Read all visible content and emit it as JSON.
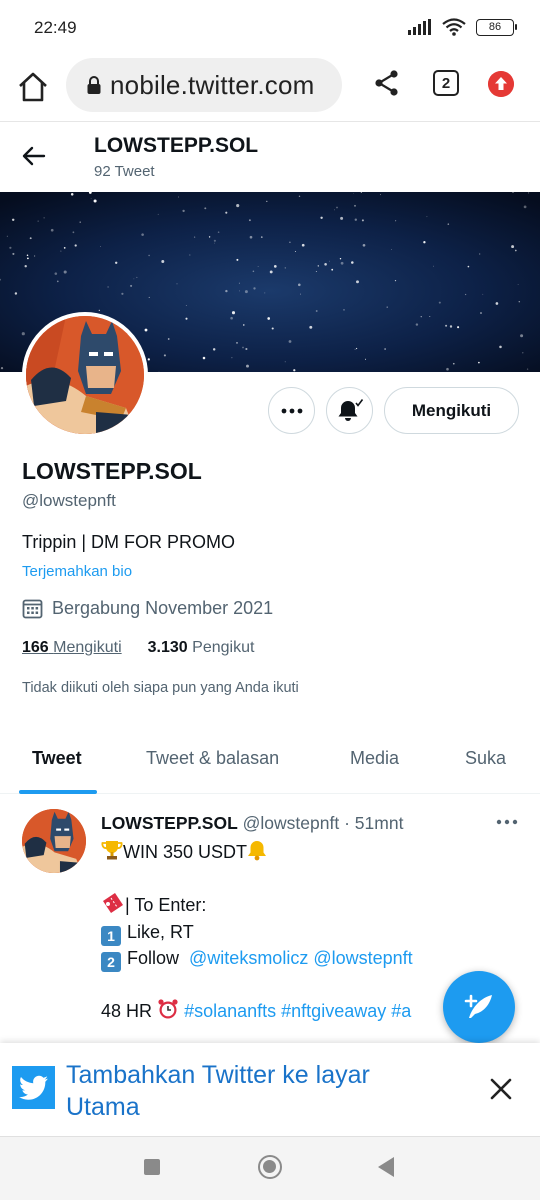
{
  "status_bar": {
    "time": "22:49",
    "battery": "86"
  },
  "browser": {
    "url": "nobile.twitter.com",
    "tab_count": "2"
  },
  "header": {
    "name": "LOWSTEPP.SOL",
    "tweet_count": "92 Tweet"
  },
  "profile": {
    "name": "LOWSTEPP.SOL",
    "handle": "@lowstepnft",
    "bio": "Trippin | DM FOR PROMO",
    "translate_bio": "Terjemahkan bio",
    "joined": "Bergabung November 2021",
    "following_count": "166",
    "following_label": "Mengikuti",
    "followers_count": "3.130",
    "followers_label": "Pengikut",
    "not_followed_text": "Tidak diikuti oleh siapa pun yang Anda ikuti",
    "follow_button": "Mengikuti"
  },
  "tabs": [
    {
      "label": "Tweet",
      "active": true
    },
    {
      "label": "Tweet & balasan",
      "active": false
    },
    {
      "label": "Media",
      "active": false
    },
    {
      "label": "Suka",
      "active": false
    }
  ],
  "tweet": {
    "name": "LOWSTEPP.SOL",
    "handle": "@lowstepnft",
    "separator": "·",
    "time": "51mnt",
    "line1": "WIN 350 USDT",
    "line2": "| To Enter:",
    "line3_num": "1",
    "line3": "Like, RT",
    "line4_num": "2",
    "line4_text": "Follow",
    "mention1": "@witeksmolicz",
    "mention2": "@lowstepnft",
    "line5_prefix": "48 HR",
    "hashtag1": "#solananfts",
    "hashtag2": "#nftgiveaway",
    "hashtag3": "#a"
  },
  "install_banner": {
    "text": "Tambahkan Twitter ke layar Utama"
  },
  "colors": {
    "twitter_blue": "#1d9bf0",
    "text_primary": "#0f1419",
    "text_secondary": "#536471"
  },
  "icons": [
    "home-icon",
    "lock-icon",
    "share-icon",
    "tabs-icon",
    "update-icon",
    "back-arrow-icon",
    "more-icon",
    "bell-icon",
    "calendar-icon",
    "trophy-icon",
    "ticket-icon",
    "alarm-clock-icon",
    "compose-icon",
    "twitter-bird-icon",
    "close-icon"
  ]
}
